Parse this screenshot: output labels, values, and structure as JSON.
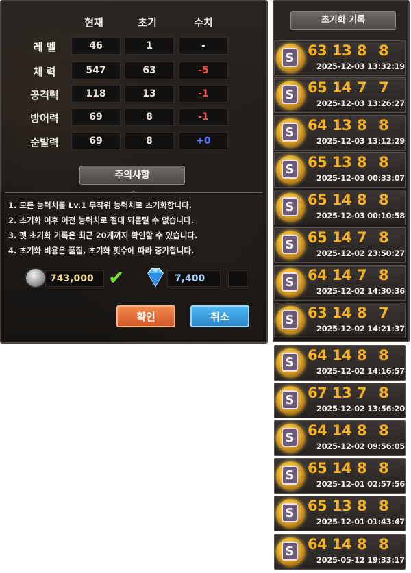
{
  "stats": {
    "headers": [
      "현재",
      "초기",
      "수치"
    ],
    "rows": [
      {
        "label": "레 벨",
        "current": "46",
        "initial": "1",
        "delta": "-",
        "delta_color": "neutral"
      },
      {
        "label": "체 력",
        "current": "547",
        "initial": "63",
        "delta": "-5",
        "delta_color": "red"
      },
      {
        "label": "공격력",
        "current": "118",
        "initial": "13",
        "delta": "-1",
        "delta_color": "red"
      },
      {
        "label": "방어력",
        "current": "69",
        "initial": "8",
        "delta": "-1",
        "delta_color": "red"
      },
      {
        "label": "순발력",
        "current": "69",
        "initial": "8",
        "delta": "+0",
        "delta_color": "blue"
      }
    ]
  },
  "notice": {
    "button_label": "주의사항",
    "lines": [
      "1. 모든 능력치를 Lv.1 무작위 능력치로 초기화합니다.",
      "2. 초기화 이후 이전 능력치로 절대 되돌릴 수 없습니다.",
      "3. 펫 초기화 기록은 최근 20개까지 확인할 수 있습니다.",
      "4. 초기화 비용은 품질, 초기화 횟수에 따라 증가합니다."
    ]
  },
  "cost": {
    "coin_icon": "soccer-ball-coin-icon",
    "coin_amount": "743,000",
    "check_icon": "check-icon",
    "gem_icon": "diamond-gem-icon",
    "gem_amount": "7,400"
  },
  "buttons": {
    "confirm_label": "확인",
    "cancel_label": "취소"
  },
  "history": {
    "title": "초기화 기록",
    "badge_letter": "S",
    "records": [
      {
        "hp": "63",
        "atk": "13",
        "def": "8",
        "agi": "8",
        "date": "2025-12-03 13:32:19"
      },
      {
        "hp": "65",
        "atk": "14",
        "def": "7",
        "agi": "7",
        "date": "2025-12-03 13:26:27"
      },
      {
        "hp": "64",
        "atk": "13",
        "def": "8",
        "agi": "8",
        "date": "2025-12-03 13:12:29"
      },
      {
        "hp": "65",
        "atk": "13",
        "def": "8",
        "agi": "8",
        "date": "2025-12-03 00:33:07"
      },
      {
        "hp": "65",
        "atk": "14",
        "def": "8",
        "agi": "8",
        "date": "2025-12-03 00:10:58"
      },
      {
        "hp": "65",
        "atk": "14",
        "def": "7",
        "agi": "8",
        "date": "2025-12-02 23:50:27"
      },
      {
        "hp": "64",
        "atk": "14",
        "def": "7",
        "agi": "8",
        "date": "2025-12-02 14:30:36"
      },
      {
        "hp": "63",
        "atk": "14",
        "def": "8",
        "agi": "7",
        "date": "2025-12-02 14:21:37"
      },
      {
        "hp": "64",
        "atk": "14",
        "def": "8",
        "agi": "8",
        "date": "2025-12-02 14:16:57"
      },
      {
        "hp": "67",
        "atk": "13",
        "def": "7",
        "agi": "8",
        "date": "2025-12-02 13:56:20"
      },
      {
        "hp": "64",
        "atk": "14",
        "def": "8",
        "agi": "8",
        "date": "2025-12-02 09:56:05"
      },
      {
        "hp": "65",
        "atk": "14",
        "def": "8",
        "agi": "8",
        "date": "2025-12-01 02:57:56"
      },
      {
        "hp": "65",
        "atk": "13",
        "def": "8",
        "agi": "8",
        "date": "2025-12-01 01:43:47"
      },
      {
        "hp": "64",
        "atk": "14",
        "def": "8",
        "agi": "8",
        "date": "2025-05-12 19:33:17"
      }
    ]
  }
}
